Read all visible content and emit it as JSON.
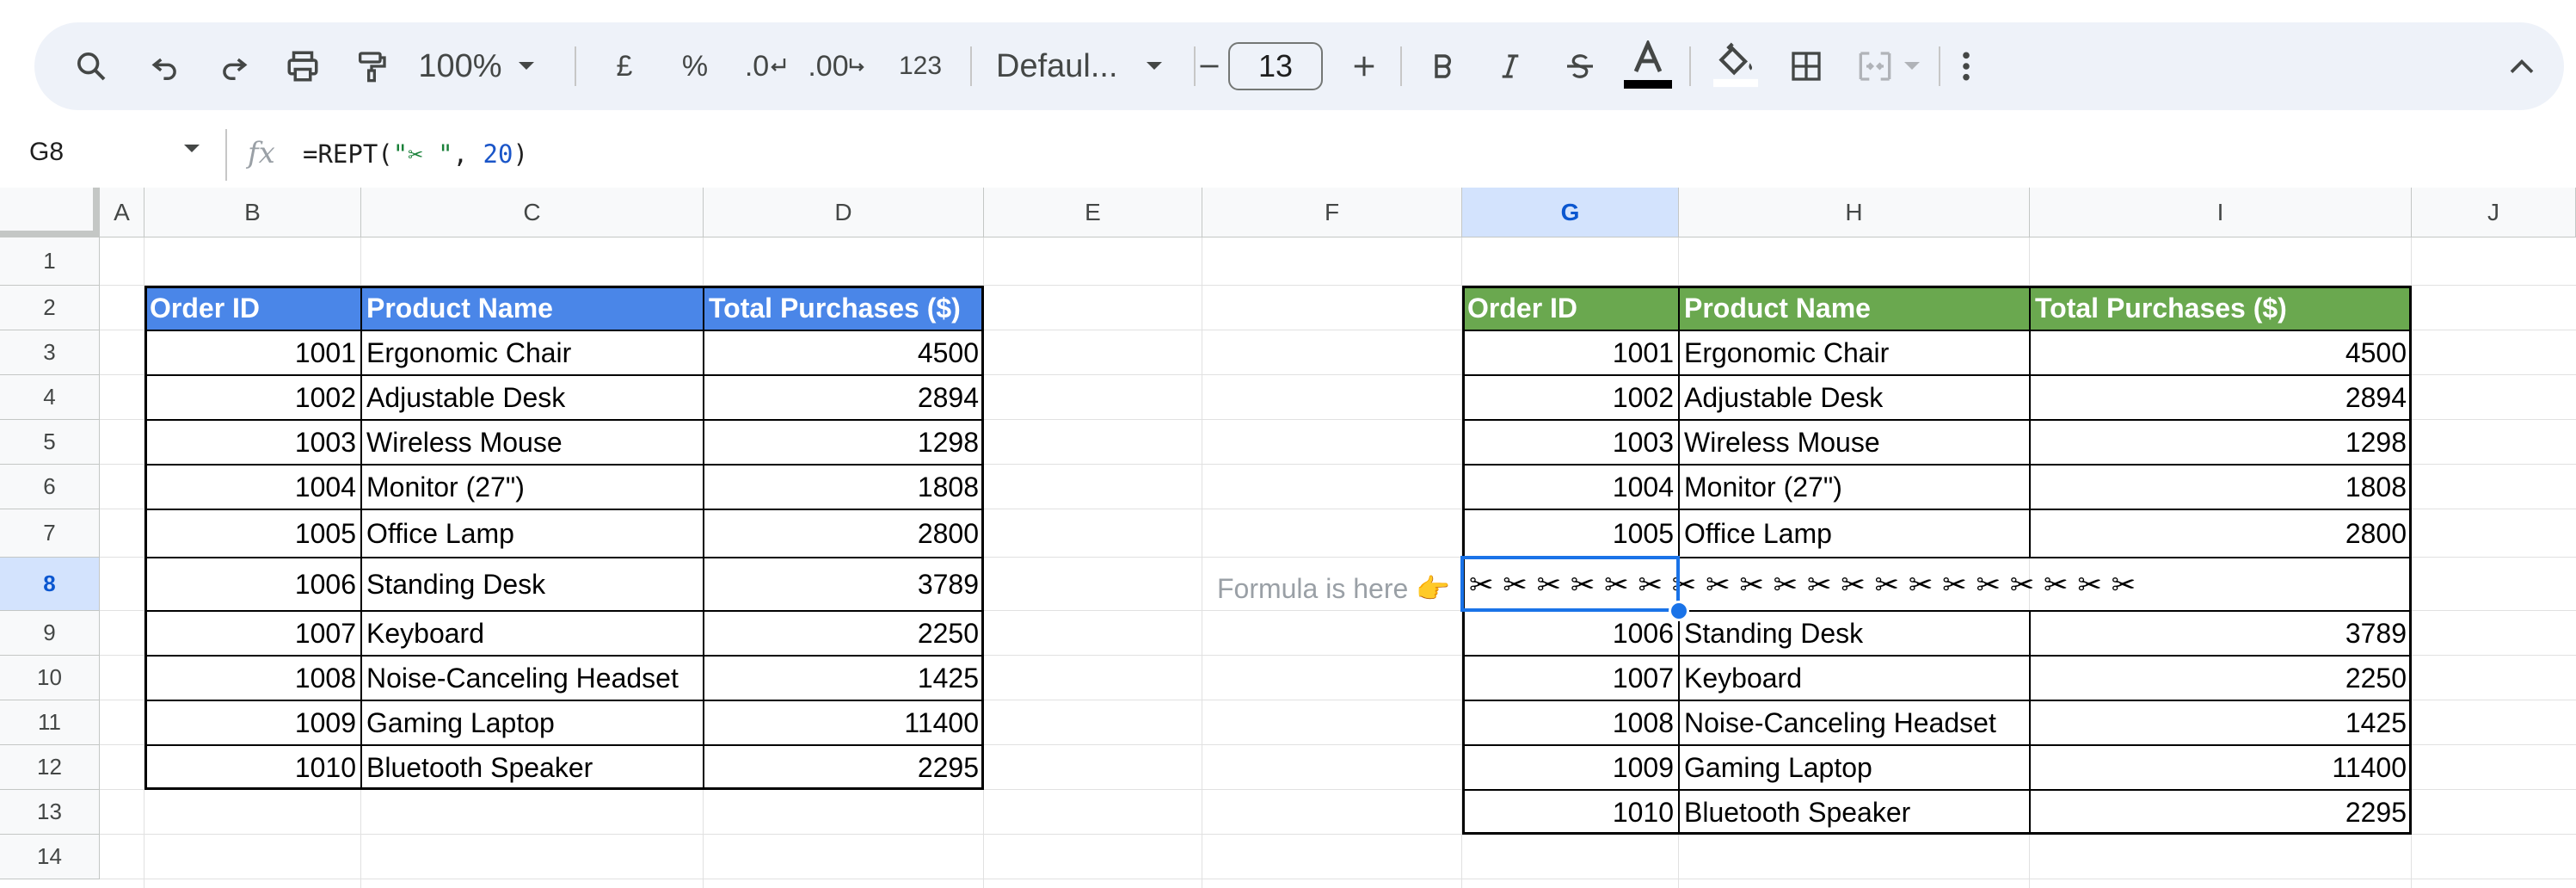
{
  "toolbar": {
    "zoom": "100%",
    "currency": "£",
    "percent": "%",
    "decrease_decimal": ".0",
    "increase_decimal": ".00",
    "number_format": "123",
    "font": "Defaul...",
    "font_size": "13"
  },
  "formula_bar": {
    "cell_ref": "G8",
    "formula_prefix": "=REPT(",
    "formula_string": "\"✂ \"",
    "formula_sep": ", ",
    "formula_number": "20",
    "formula_suffix": ")"
  },
  "columns": [
    "A",
    "B",
    "C",
    "D",
    "E",
    "F",
    "G",
    "H",
    "I",
    "J"
  ],
  "rows": [
    "1",
    "2",
    "3",
    "4",
    "5",
    "6",
    "7",
    "8",
    "9",
    "10",
    "11",
    "12",
    "13",
    "14"
  ],
  "selected_column": "G",
  "selected_row": "8",
  "left_table": {
    "header_color": "#4a86e8",
    "headers": [
      "Order ID",
      "Product Name",
      "Total Purchases ($)"
    ],
    "rows": [
      [
        "1001",
        "Ergonomic Chair",
        "4500"
      ],
      [
        "1002",
        "Adjustable Desk",
        "2894"
      ],
      [
        "1003",
        "Wireless Mouse",
        "1298"
      ],
      [
        "1004",
        "Monitor (27\")",
        "1808"
      ],
      [
        "1005",
        "Office Lamp",
        "2800"
      ],
      [
        "1006",
        "Standing Desk",
        "3789"
      ],
      [
        "1007",
        "Keyboard",
        "2250"
      ],
      [
        "1008",
        "Noise-Canceling Headset",
        "1425"
      ],
      [
        "1009",
        "Gaming Laptop",
        "11400"
      ],
      [
        "1010",
        "Bluetooth Speaker",
        "2295"
      ]
    ]
  },
  "right_table": {
    "header_color": "#6aa84f",
    "headers": [
      "Order ID",
      "Product Name",
      "Total Purchases ($)"
    ],
    "rows_top": [
      [
        "1001",
        "Ergonomic Chair",
        "4500"
      ],
      [
        "1002",
        "Adjustable Desk",
        "2894"
      ],
      [
        "1003",
        "Wireless Mouse",
        "1298"
      ],
      [
        "1004",
        "Monitor (27\")",
        "1808"
      ],
      [
        "1005",
        "Office Lamp",
        "2800"
      ]
    ],
    "separator_text": "✂ ✂ ✂ ✂ ✂ ✂ ✂ ✂ ✂ ✂ ✂ ✂ ✂ ✂ ✂ ✂ ✂ ✂ ✂ ✂",
    "rows_bottom": [
      [
        "1006",
        "Standing Desk",
        "3789"
      ],
      [
        "1007",
        "Keyboard",
        "2250"
      ],
      [
        "1008",
        "Noise-Canceling Headset",
        "1425"
      ],
      [
        "1009",
        "Gaming Laptop",
        "11400"
      ],
      [
        "1010",
        "Bluetooth Speaker",
        "2295"
      ]
    ]
  },
  "note": "Formula is here 👉",
  "colors": {
    "toolbar_bg": "#eef2f9",
    "selection": "#1a73e8",
    "header_selected_bg": "#d3e3fd"
  }
}
